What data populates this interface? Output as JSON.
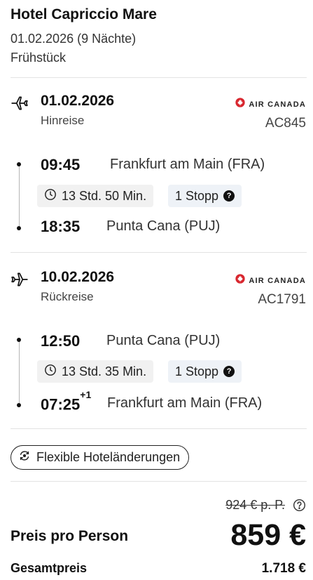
{
  "hotel": {
    "name": "Hotel Capriccio Mare",
    "dates": "01.02.2026 (9 Nächte)",
    "board": "Frühstück"
  },
  "outbound": {
    "date": "01.02.2026",
    "direction": "Hinreise",
    "airline": "AIR CANADA",
    "flight_number": "AC845",
    "departure_time": "09:45",
    "departure_place": "Frankfurt am Main (FRA)",
    "duration": "13 Std. 50 Min.",
    "stops": "1 Stopp",
    "arrival_time": "18:35",
    "arrival_day_offset": "",
    "arrival_place": "Punta Cana (PUJ)",
    "icon": "plane-departure-icon"
  },
  "return": {
    "date": "10.02.2026",
    "direction": "Rückreise",
    "airline": "AIR CANADA",
    "flight_number": "AC1791",
    "departure_time": "12:50",
    "departure_place": "Punta Cana (PUJ)",
    "duration": "13 Std. 35 Min.",
    "stops": "1 Stopp",
    "arrival_time": "07:25",
    "arrival_day_offset": "+1",
    "arrival_place": "Frankfurt am Main (FRA)",
    "icon": "plane-return-icon"
  },
  "flex_button": {
    "label": "Flexible Hoteländerungen",
    "icon": "flex-change-icon"
  },
  "pricing": {
    "old_price": "924 € p. P.",
    "per_person_label": "Preis pro Person",
    "per_person_value": "859 €",
    "total_label": "Gesamtpreis",
    "total_value": "1.718 €"
  },
  "colors": {
    "air_canada_red": "#d8262e",
    "text": "#111111",
    "divider": "#e3e3e3",
    "chip_bg": "#f1f1f1"
  }
}
